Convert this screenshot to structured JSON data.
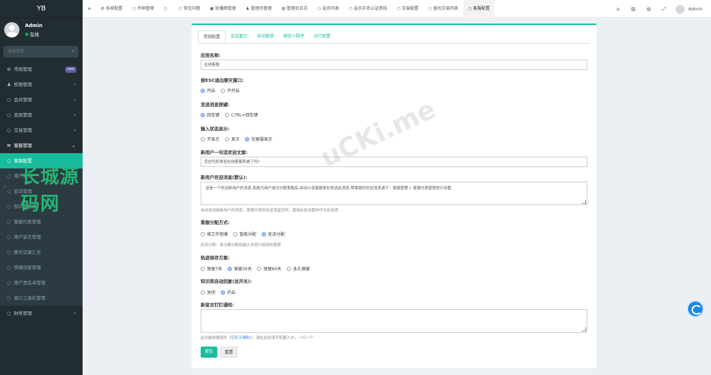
{
  "app": {
    "logo": "YB"
  },
  "user": {
    "name": "Admin",
    "status": "在线"
  },
  "search": {
    "placeholder": "搜索菜单"
  },
  "sidebar": {
    "items": [
      {
        "label": "常规管理",
        "badge": "new"
      },
      {
        "label": "权限管理"
      },
      {
        "label": "会员管理"
      },
      {
        "label": "发现管理"
      },
      {
        "label": "交易管理"
      },
      {
        "label": "客服管理"
      }
    ],
    "sub": [
      "客服配置",
      "用户管理",
      "会话管理",
      "知识库管理",
      "客服代表管理",
      "用户留言管理",
      "聊天记录汇总",
      "快捷回复管理",
      "用户黑名单管理",
      "窗口工具栏管理"
    ],
    "last": {
      "label": "财务管理"
    }
  },
  "watermark": {
    "text": "长城源码网",
    "text2": "uCKi.me"
  },
  "topbar": {
    "tabs": [
      "系统配置",
      "币种管理",
      "",
      "常见问题",
      "轮播图管理",
      "管理员管理",
      "管理员日志",
      "会员列表",
      "会员实名认证审核",
      "交易配置",
      "委托交易列表",
      "客服配置"
    ],
    "user": "Admin"
  },
  "form": {
    "tabs": [
      "常规配置",
      "会话窗口",
      "自动邀请",
      "微信小程序",
      "运行配置"
    ],
    "app_name": {
      "label": "应用名称:",
      "value": "在线客服"
    },
    "esc": {
      "label": "按ESC退出聊天窗口:",
      "options": [
        "开启",
        "不开启"
      ]
    },
    "send_key": {
      "label": "发送消息按键:",
      "options": [
        "回车键",
        "CTRL+回车键"
      ]
    },
    "typing": {
      "label": "输入状态显示:",
      "options": [
        "不显示",
        "显示",
        "仅客服显示"
      ]
    },
    "greeting": {
      "label": "新用户一句话欢迎文案:",
      "value": "您在吗好体验在线客服系统了吗?"
    },
    "welcome": {
      "label": "新用户欢迎消息(默认):",
      "value": "这是一个欢迎新用户的消息,系统为用户成功分配客服后,自动以该客服身份发送此消息-帮客服的欢迎消息请于：客服管理 》客服代表管理进行设置",
      "help": "自动发送给新用户的消息，客服代表的欢迎语留空时，使用此处设置的作为欢迎语"
    },
    "assign": {
      "label": "客服分配方式:",
      "options": [
        "按工作饱满",
        "智能分配",
        "轮流分配"
      ],
      "help": "轮流分配：每次都分配给最久未进行接待的客服"
    },
    "keep": {
      "label": "轨迹保存方案:",
      "options": [
        "保留7天",
        "保留30天",
        "保留60天",
        "永久保留"
      ]
    },
    "kb": {
      "label": "知识库自动回复(总开关):",
      "options": [
        "关闭",
        "开启"
      ]
    },
    "ding": {
      "label": "新留言钉钉通知:",
      "help_pre": "此功能依赖插件《",
      "help_link": "钉钉小喇叭",
      "help_post": "》，请在此处填写机器人ID，一行一个"
    },
    "submit": "提交",
    "reset": "重置"
  }
}
